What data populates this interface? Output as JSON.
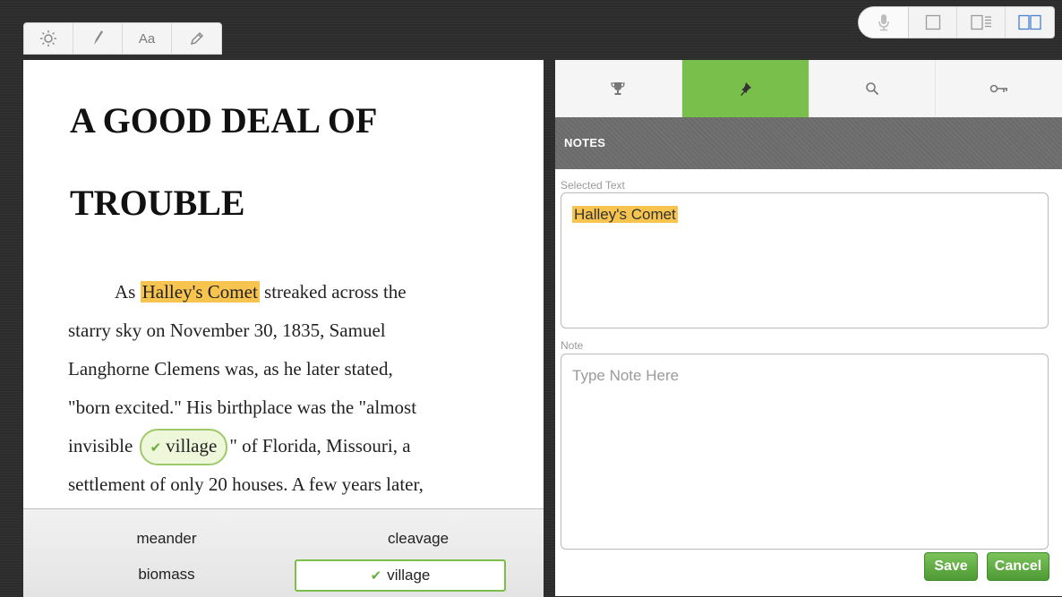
{
  "toolbar": {
    "aa_label": "Aa"
  },
  "chapter": {
    "title_line1": "A GOOD DEAL OF",
    "title_line2": "TROUBLE"
  },
  "body": {
    "l1_pre": "As ",
    "l1_highlight": "Halley's Comet",
    "l1_post": " streaked across the",
    "l2": "starry sky on November 30, 1835, Samuel",
    "l3": "Langhorne Clemens was, as he later stated,",
    "l4": "\"born excited.\" His birthplace was the \"almost",
    "l5_pre": "invisible ",
    "l5_vocab": "village",
    "l5_post": "\" of Florida, Missouri, a",
    "l6": "settlement of only 20 houses. A few years later,"
  },
  "vocab_tray": {
    "words": [
      "meander",
      "cleavage",
      "biomass",
      "village"
    ]
  },
  "notes_panel": {
    "header": "NOTES",
    "selected_text_label": "Selected Text",
    "selected_text_value": "Halley's Comet",
    "note_label": "Note",
    "note_placeholder": "Type Note Here",
    "save_label": "Save",
    "cancel_label": "Cancel"
  },
  "colors": {
    "highlight": "#f8c450",
    "accent_green": "#78bf4c",
    "notes_header": "#6a6a6a"
  },
  "icons": {
    "toolbar": [
      "brightness-icon",
      "pen-icon",
      "font-size-icon",
      "pencil-icon"
    ],
    "view": [
      "microphone-icon",
      "single-page-icon",
      "text-sidebar-icon",
      "double-page-icon"
    ],
    "tabs": [
      "trophy-icon",
      "pin-icon",
      "search-icon",
      "key-icon"
    ]
  }
}
